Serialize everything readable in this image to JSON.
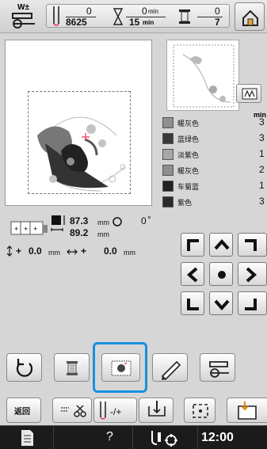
{
  "header": {
    "wt_label": "W±",
    "stitch_current": "0",
    "stitch_total": "8625",
    "time_current": "0",
    "time_current_unit": "min",
    "time_total": "15",
    "time_total_unit": "min",
    "color_current": "0",
    "color_total": "7"
  },
  "threads": {
    "min_label": "min",
    "items": [
      {
        "name": "暖灰色",
        "count": "3",
        "color": "#8f8f8f"
      },
      {
        "name": "蓝绿色",
        "count": "3",
        "color": "#3a3a3a"
      },
      {
        "name": "淡紫色",
        "count": "1",
        "color": "#a7a7a7"
      },
      {
        "name": "暖灰色",
        "count": "2",
        "color": "#8f8f8f"
      },
      {
        "name": "车菊蓝",
        "count": "1",
        "color": "#222222"
      },
      {
        "name": "紫色",
        "count": "3",
        "color": "#2a2a2a"
      }
    ]
  },
  "size_info": {
    "width_value": "87.3",
    "width_unit": "mm",
    "height_value": "89.2",
    "height_unit": "mm",
    "angle_value": "0",
    "angle_unit": "°",
    "y_offset_value": "0.0",
    "y_offset_unit": "mm",
    "x_offset_value": "0.0",
    "x_offset_unit": "mm",
    "y_prefix": "+",
    "x_prefix": "+"
  },
  "bottom": {
    "back_label": "返回",
    "time": "12:00",
    "help": "?"
  }
}
